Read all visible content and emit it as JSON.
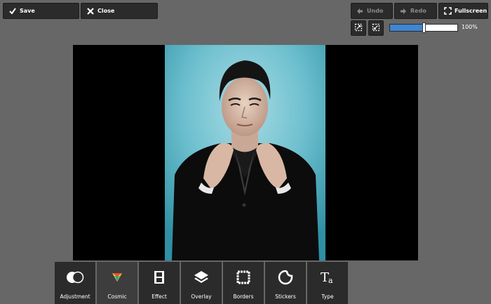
{
  "toolbar_top": {
    "save_label": "Save",
    "close_label": "Close",
    "undo_label": "Undo",
    "redo_label": "Redo",
    "fullscreen_label": "Fullscreen"
  },
  "zoom": {
    "value_label": "100%",
    "level_fraction": 0.5
  },
  "tools": [
    {
      "label": "Adjustment",
      "icon": "adjustment-icon"
    },
    {
      "label": "Cosmic",
      "icon": "cosmic-icon"
    },
    {
      "label": "Effect",
      "icon": "film-icon"
    },
    {
      "label": "Overlay",
      "icon": "layers-icon"
    },
    {
      "label": "Borders",
      "icon": "frame-icon"
    },
    {
      "label": "Stickers",
      "icon": "sticker-icon"
    },
    {
      "label": "Type",
      "icon": "type-icon"
    }
  ],
  "colors": {
    "background": "#676767",
    "button": "#2b2b2b",
    "accent": "#3f86d3",
    "photo_backdrop": "#5fb3c6"
  }
}
